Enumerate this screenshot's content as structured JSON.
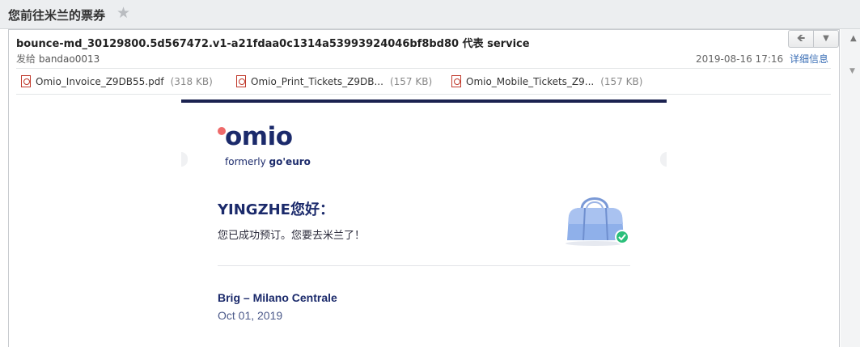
{
  "subject": {
    "title": "您前往米兰的票券",
    "star_icon": "star-icon"
  },
  "header": {
    "from": "bounce-md_30129800.5d567472.v1-a21fdaa0c1314a53993924046bf8bd80 代表 service",
    "to_prefix": "发给",
    "to_name": "bandao0013",
    "datetime": "2019-08-16 17:16",
    "details_link": "详细信息",
    "reply_icon": "reply-icon",
    "more_icon": "chevron-down-icon"
  },
  "attachments": [
    {
      "name": "Omio_Invoice_Z9DB55.pdf",
      "size": "(318 KB)"
    },
    {
      "name": "Omio_Print_Tickets_Z9DB...",
      "size": "(157 KB)"
    },
    {
      "name": "Omio_Mobile_Tickets_Z9...",
      "size": "(157 KB)"
    }
  ],
  "email": {
    "logo_text": "omio",
    "logo_sub_prefix": "formerly ",
    "logo_sub_brand": "go'euro",
    "greeting": "YINGZHE您好：",
    "confirmation": "您已成功预订。您要去米兰了！",
    "route": "Brig – Milano Centrale",
    "date": "Oct 01, 2019"
  },
  "colors": {
    "brand_navy": "#1b2a6b",
    "brand_coral": "#ee6a6a",
    "link": "#3b6fb6",
    "success_green": "#2bbf7a"
  }
}
